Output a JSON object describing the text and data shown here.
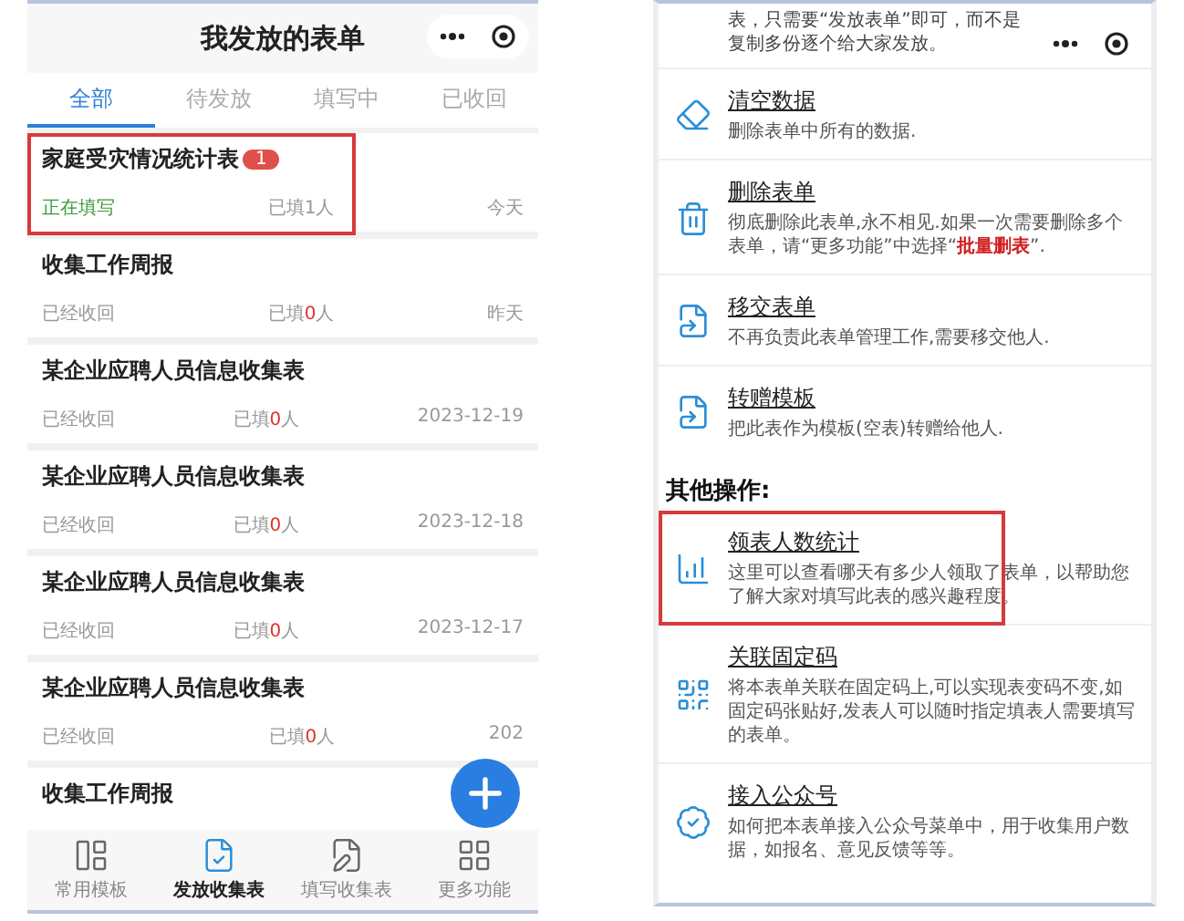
{
  "left_screen": {
    "title": "我发放的表单",
    "tabs": [
      {
        "label": "全部",
        "selected": true
      },
      {
        "label": "待发放",
        "selected": false
      },
      {
        "label": "填写中",
        "selected": false
      },
      {
        "label": "已收回",
        "selected": false
      }
    ],
    "forms": [
      {
        "title": "家庭受灾情况统计表",
        "badge": "1",
        "status": "正在填写",
        "active": true,
        "filled_before": "已填",
        "filled_count": "1",
        "filled_after": "人",
        "alert": false,
        "date": "今天",
        "highlighted": true
      },
      {
        "title": "收集工作周报",
        "status": "已经收回",
        "active": false,
        "filled_before": "已填",
        "filled_count": "0",
        "filled_after": "人",
        "alert": true,
        "date": "昨天",
        "highlighted": false
      },
      {
        "title": "某企业应聘人员信息收集表",
        "status": "已经收回",
        "active": false,
        "filled_before": "已填",
        "filled_count": "0",
        "filled_after": "人",
        "alert": true,
        "date": "2023-12-19",
        "highlighted": false
      },
      {
        "title": "某企业应聘人员信息收集表",
        "status": "已经收回",
        "active": false,
        "filled_before": "已填",
        "filled_count": "0",
        "filled_after": "人",
        "alert": true,
        "date": "2023-12-18",
        "highlighted": false
      },
      {
        "title": "某企业应聘人员信息收集表",
        "status": "已经收回",
        "active": false,
        "filled_before": "已填",
        "filled_count": "0",
        "filled_after": "人",
        "alert": true,
        "date": "2023-12-17",
        "highlighted": false
      },
      {
        "title": "某企业应聘人员信息收集表",
        "status": "已经收回",
        "active": false,
        "filled_before": "已填",
        "filled_count": "0",
        "filled_after": "人",
        "alert": true,
        "date": "202",
        "highlighted": false
      },
      {
        "title": "收集工作周报",
        "highlighted": false
      }
    ],
    "tabbar": [
      {
        "label": "常用模板",
        "kind": "templates",
        "selected": false
      },
      {
        "label": "发放收集表",
        "kind": "issue",
        "selected": true
      },
      {
        "label": "填写收集表",
        "kind": "fill",
        "selected": false
      },
      {
        "label": "更多功能",
        "kind": "more",
        "selected": false
      }
    ]
  },
  "right_screen": {
    "intro": "表，只需要“发放表单”即可，而不是复制多份逐个给大家发放。",
    "actions": [
      {
        "kind": "clear",
        "title": "清空数据",
        "description": "删除表单中所有的数据.",
        "highlighted": false
      },
      {
        "kind": "delete",
        "title": "删除表单",
        "description": "彻底删除此表单,永不相见.如果一次需要删除多个表单，请“更多功能”中选择“**批量删表**”.",
        "highlighted": false
      },
      {
        "kind": "transfer",
        "title": "移交表单",
        "description": "不再负责此表单管理工作,需要移交他人.",
        "highlighted": false
      },
      {
        "kind": "transfer",
        "title": "转赠模板",
        "description": "把此表作为模板(空表)转赠给他人.",
        "highlighted": false
      }
    ],
    "section_title": "其他操作:",
    "other_actions": [
      {
        "kind": "stats",
        "title": "领表人数统计",
        "description": "这里可以查看哪天有多少人领取了表单，以帮助您了解大家对填写此表的感兴趣程度。",
        "highlighted": true
      },
      {
        "kind": "qr",
        "title": "关联固定码",
        "description": "将本表单关联在固定码上,可以实现表变码不变,如固定码张贴好,发表人可以随时指定填表人需要填写的表单。",
        "highlighted": false
      },
      {
        "kind": "account",
        "title": "接入公众号",
        "description": "如何把本表单接入公众号菜单中，用于收集用户数据，如报名、意见反馈等等。",
        "highlighted": false
      }
    ]
  }
}
